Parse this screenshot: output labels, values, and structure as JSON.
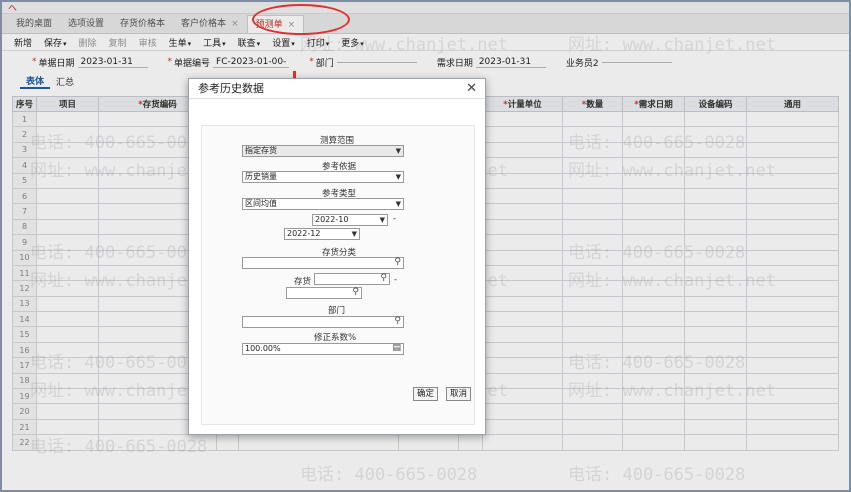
{
  "tabs": [
    {
      "label": "我的桌面"
    },
    {
      "label": "选项设置"
    },
    {
      "label": "存货价格本"
    },
    {
      "label": "客户价格本"
    },
    {
      "label": "预测单",
      "active": true
    }
  ],
  "toolbar": [
    "新增",
    "保存",
    "删除",
    "复制",
    "审核",
    "生单",
    "工具",
    "联查",
    "设置",
    "打印",
    "更多"
  ],
  "header": {
    "date_label": "单据日期",
    "date_value": "2023-01-31",
    "code_label": "单据编号",
    "code_value": "FC-2023-01-00-",
    "dept_label": "部门",
    "dept_value": "",
    "need_date_label": "需求日期",
    "need_date_value": "2023-01-31",
    "clerk_label": "业务员2",
    "clerk_value": ""
  },
  "subtabs": [
    "表体",
    "汇总"
  ],
  "grid": {
    "columns": [
      "序号",
      "项目",
      "存货编码",
      "",
      "",
      "",
      "",
      "计量单位",
      "数量",
      "需求日期",
      "设备编码",
      "通用"
    ],
    "rows": [
      "1",
      "2",
      "3",
      "4",
      "5",
      "6",
      "7",
      "8",
      "9",
      "10",
      "11",
      "12",
      "13",
      "14",
      "15",
      "16",
      "17",
      "18",
      "19",
      "20",
      "21",
      "22"
    ]
  },
  "watermark": {
    "phone": "电话: 400-665-0028",
    "site": "网址: www.chanjet.net"
  },
  "dialog": {
    "title": "参考历史数据",
    "range_label": "测算范围",
    "range_value": "指定存货",
    "basis_label": "参考依据",
    "basis_value": "历史销量",
    "type_label": "参考类型",
    "type_value": "区间均值",
    "from_period": "2022-10",
    "dash": "-",
    "to_period": "2022-12",
    "category_label": "存货分类",
    "inventory_label": "存货",
    "dept_label": "部门",
    "coef_label": "修正系数%",
    "coef_value": "100.00%",
    "ok_label": "确定",
    "cancel_label": "取消"
  },
  "colors": {
    "accent_red": "#e0302d",
    "header_blue": "#1f5fa8"
  }
}
